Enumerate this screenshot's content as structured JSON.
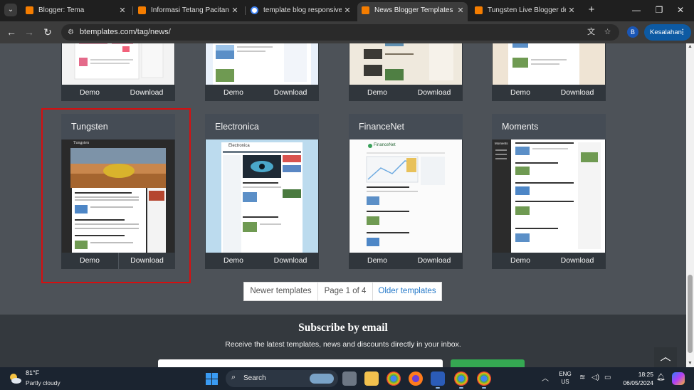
{
  "browser": {
    "tabs": [
      {
        "title": "Blogger: Tema",
        "favicon": "blogger-icon",
        "active": false
      },
      {
        "title": "Informasi Tetang Pacitan",
        "favicon": "blogger-icon",
        "active": false
      },
      {
        "title": "template blog responsive fre",
        "favicon": "google-icon",
        "active": false
      },
      {
        "title": "News Blogger Templates - B",
        "favicon": "blogger-icon",
        "active": true
      },
      {
        "title": "Tungsten Live Blogger demo",
        "favicon": "blogger-icon",
        "active": false
      }
    ],
    "url": "btemplates.com/tag/news/",
    "profile_initial": "B",
    "error_chip": "Kesalahan"
  },
  "templates": {
    "top_row_actions": [
      {
        "demo": "Demo",
        "download": "Download"
      },
      {
        "demo": "Demo",
        "download": "Download"
      },
      {
        "demo": "Demo",
        "download": "Download"
      },
      {
        "demo": "Demo",
        "download": "Download"
      }
    ],
    "cards": [
      {
        "name": "Tungsten",
        "demo": "Demo",
        "download": "Download",
        "preview_heading": "Tungsten"
      },
      {
        "name": "Electronica",
        "demo": "Demo",
        "download": "Download",
        "preview_heading": "Electronica"
      },
      {
        "name": "FinanceNet",
        "demo": "Demo",
        "download": "Download",
        "preview_heading": "FinanceNet"
      },
      {
        "name": "Moments",
        "demo": "Demo",
        "download": "Download",
        "preview_heading": "Moments"
      }
    ]
  },
  "pagination": {
    "newer": "Newer templates",
    "status": "Page 1 of 4",
    "older": "Older templates"
  },
  "subscribe": {
    "title": "Subscribe by email",
    "description": "Receive the latest templates, news and discounts directly in your inbox."
  },
  "taskbar": {
    "temperature": "81°F",
    "condition": "Partly cloudy",
    "search_label": "Search",
    "language_line1": "ENG",
    "language_line2": "US",
    "time": "18:25",
    "date": "06/05/2024"
  },
  "colors": {
    "page_bg": "#4d5258",
    "highlight_border": "#d60f10",
    "link_blue": "#2579c9",
    "subscribe_button": "#35a852"
  }
}
